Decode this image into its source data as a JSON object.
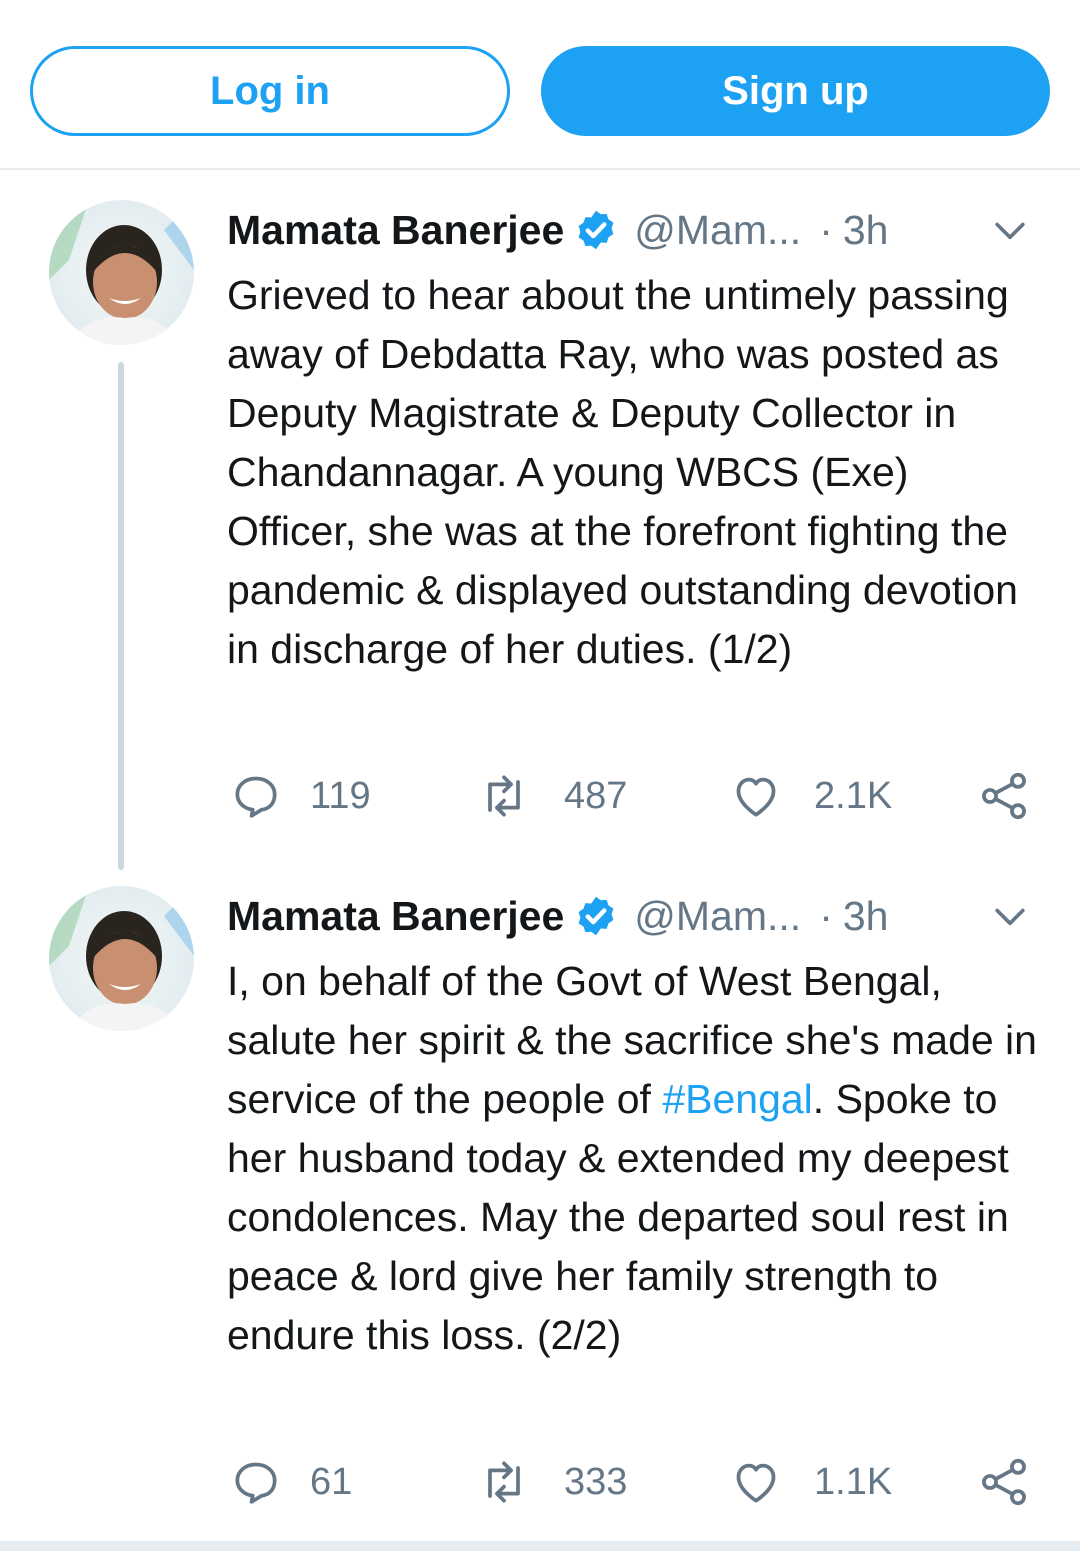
{
  "topbar": {
    "login_label": "Log in",
    "signup_label": "Sign up"
  },
  "colors": {
    "accent": "#1da1f2",
    "text": "#14171a",
    "muted": "#657786",
    "border": "#e6ecf0"
  },
  "tweets": [
    {
      "name": "Mamata Banerjee",
      "handle": "@Mam...",
      "dot": "·",
      "time": "3h",
      "text": "Grieved to hear about the untimely passing away of Debdatta Ray, who was posted as Deputy Magistrate & Deputy Collector in Chandannagar. A young WBCS (Exe) Officer, she was at the forefront fighting the pandemic & displayed outstanding devotion in discharge of her duties. (1/2)",
      "replies": "119",
      "retweets": "487",
      "likes": "2.1K"
    },
    {
      "name": "Mamata Banerjee",
      "handle": "@Mam...",
      "dot": "·",
      "time": "3h",
      "text_before": "I, on behalf of the Govt of West Bengal, salute her spirit & the sacrifice she's made in service of the people of ",
      "hashtag": "#Bengal",
      "text_after": ". Spoke to her husband today & extended my deepest condolences. May the departed soul rest in peace & lord give her family strength to endure this loss. (2/2)",
      "replies": "61",
      "retweets": "333",
      "likes": "1.1K"
    }
  ],
  "icons": [
    "verified-badge-icon",
    "chevron-down-icon",
    "reply-icon",
    "retweet-icon",
    "like-icon",
    "share-icon"
  ]
}
